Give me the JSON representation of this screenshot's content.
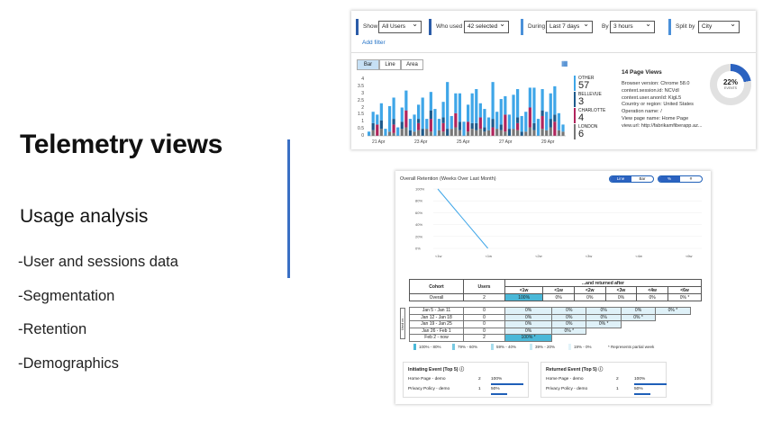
{
  "slide": {
    "title": "Telemetry views",
    "subtitle": "Usage analysis",
    "bullets": [
      "-User and sessions data",
      "-Segmentation",
      "-Retention",
      "-Demographics"
    ],
    "accent": "#3a6fc4"
  },
  "usage": {
    "filters": {
      "show_label": "Show",
      "show_value": "All Users",
      "who_label": "Who used",
      "who_value": "42 selected",
      "during_label": "During",
      "during_value": "Last 7 days",
      "by_label": "By",
      "by_value": "3 hours",
      "split_label": "Split by",
      "split_value": "City"
    },
    "add_filter": "Add filter",
    "chart_types": [
      "Bar",
      "Line",
      "Area"
    ],
    "selected_chart_type": "Bar",
    "legend": [
      {
        "name": "OTHER",
        "value": "57",
        "color": "#3fa6e8"
      },
      {
        "name": "BELLEVUE",
        "value": "3",
        "color": "#1e5a8c"
      },
      {
        "name": "CHARLOTTE",
        "value": "4",
        "color": "#b0245c"
      },
      {
        "name": "LONDON",
        "value": "6",
        "color": "#777777"
      }
    ],
    "page_views_title": "14 Page Views",
    "details": [
      "Browser version: Chrome 58.0",
      "context.session.id: NCVdl",
      "context.user.anonId: KigL5",
      "Country or region: United States",
      "Operation name: /",
      "View page name: Home Page",
      "view.url: http://fabrikamfiberapp.az..."
    ],
    "donut_pct": "22%",
    "donut_label": "EVENTS",
    "donut_fraction": 0.22
  },
  "chart_data": {
    "type": "bar",
    "title": "",
    "xlabel": "",
    "ylabel": "",
    "ylim": [
      0,
      4
    ],
    "yticks": [
      "4",
      "3.5",
      "3",
      "2.5",
      "2",
      "1.5",
      "1",
      "0.5",
      "0"
    ],
    "xticks": [
      "21 Apr",
      "23 Apr",
      "25 Apr",
      "27 Apr",
      "29 Apr"
    ],
    "stacked": true,
    "series": [
      {
        "name": "LONDON",
        "color": "#777777",
        "values": [
          0,
          0.4,
          0,
          0.5,
          0,
          0.3,
          0.2,
          0,
          0.5,
          0.6,
          0,
          0.3,
          0.4,
          0,
          0.5,
          0.3,
          0,
          0.4,
          0.3,
          0,
          0.5,
          0.6,
          0.4,
          0,
          0.3,
          0.5,
          0.4,
          0.5,
          0.3,
          0.4,
          0,
          0.5,
          0.4,
          0.3,
          0,
          0.5,
          0.4,
          0,
          0.3,
          0.6,
          0.4,
          0,
          0.5,
          0.4,
          0.6,
          0,
          0.4,
          0.3
        ]
      },
      {
        "name": "CHARLOTTE",
        "color": "#b0245c",
        "values": [
          0,
          0,
          0.8,
          0,
          0,
          0,
          0.6,
          0,
          0,
          1.2,
          0,
          0,
          0.5,
          0,
          0,
          0.9,
          0,
          0,
          0.6,
          0,
          0,
          1.0,
          0,
          0,
          0.7,
          0,
          0,
          0.8,
          0,
          0,
          0.6,
          0,
          0,
          1.2,
          0,
          0,
          0.5,
          0,
          0,
          1.4,
          0,
          0,
          0.9,
          0,
          0,
          1.0,
          0,
          0
        ]
      },
      {
        "name": "BELLEVUE",
        "color": "#1e5a8c",
        "values": [
          0,
          0.5,
          0,
          0.6,
          0,
          0,
          0.4,
          0,
          0.5,
          0,
          0.4,
          0,
          0.3,
          0.5,
          0,
          0.6,
          0,
          0,
          0.4,
          0.5,
          0,
          0,
          0.6,
          0,
          0,
          0.4,
          0.5,
          0,
          0.3,
          0,
          0.6,
          0,
          0.4,
          0,
          0.5,
          0,
          0.4,
          0.3,
          0,
          0,
          0.5,
          0,
          0.4,
          0,
          0.6,
          0.5,
          0,
          0
        ]
      },
      {
        "name": "OTHER",
        "color": "#3fa6e8",
        "values": [
          0.3,
          0.8,
          0.7,
          1.2,
          0.5,
          1.8,
          1.5,
          0.6,
          1.0,
          1.4,
          0.8,
          1.2,
          1.0,
          2.2,
          0.7,
          1.3,
          1.9,
          0.8,
          1.1,
          3.3,
          0.9,
          1.4,
          2.0,
          1.0,
          1.2,
          2.1,
          2.4,
          1.0,
          1.3,
          0.9,
          2.6,
          1.2,
          1.8,
          1.3,
          1.0,
          2.4,
          2.0,
          1.1,
          1.4,
          1.4,
          2.5,
          1.2,
          1.5,
          1.3,
          1.8,
          2.0,
          1.2,
          0.5
        ]
      }
    ]
  },
  "retention": {
    "title": "Overall Retention (Weeks Over Last Month)",
    "view_toggle": [
      "Line",
      "Bar"
    ],
    "unit_toggle": [
      "%",
      "#"
    ],
    "line_yticks": [
      "100%",
      "80%",
      "60%",
      "40%",
      "20%",
      "0%"
    ],
    "line_xticks": [
      "<1w",
      "<1w",
      "<2w",
      "<3w",
      "<4w",
      "<6w"
    ],
    "line_points": [
      100,
      0,
      0,
      0,
      0,
      0
    ],
    "table_headers": [
      "Cohort",
      "Users",
      "...and returned after"
    ],
    "table_periods": [
      "<1w",
      "<1w",
      "<2w",
      "<3w",
      "<4w",
      "<6w"
    ],
    "overall": [
      "Overall",
      "2",
      "100%",
      "0%",
      "0%",
      "0%",
      "0%",
      "0% *"
    ],
    "cohort_axis": "Used on...",
    "cohorts": [
      {
        "label": "Jan 5 - Jan 11",
        "users": "0",
        "cells": [
          "0%",
          "0%",
          "0%",
          "0%",
          "0% *"
        ]
      },
      {
        "label": "Jan 12 - Jan 18",
        "users": "0",
        "cells": [
          "0%",
          "0%",
          "0%",
          "0% *"
        ]
      },
      {
        "label": "Jan 19 - Jan 25",
        "users": "0",
        "cells": [
          "0%",
          "0%",
          "0% *"
        ]
      },
      {
        "label": "Jan 26 - Feb 1",
        "users": "0",
        "cells": [
          "0%",
          "0% *"
        ]
      },
      {
        "label": "Feb 2 - now",
        "users": "2",
        "cells": [
          "100% *"
        ]
      }
    ],
    "legend": [
      {
        "label": "100% - 80%",
        "color": "#4ab8d8"
      },
      {
        "label": "79% - 60%",
        "color": "#78c9e2"
      },
      {
        "label": "59% - 40%",
        "color": "#a6dcec"
      },
      {
        "label": "39% - 20%",
        "color": "#c8e9f3"
      },
      {
        "label": "19% - 0%",
        "color": "#e2f3f9"
      }
    ],
    "partial_note": "* Represents partial week",
    "initiating": {
      "title": "Initiating Event (Top 5)",
      "rows": [
        {
          "name": "Home Page - demo",
          "count": "2",
          "pct": "100%",
          "frac": 1.0
        },
        {
          "name": "Privacy Policy - demo",
          "count": "1",
          "pct": "50%",
          "frac": 0.5
        }
      ]
    },
    "returned": {
      "title": "Returned Event (Top 5)",
      "rows": [
        {
          "name": "Home Page - demo",
          "count": "2",
          "pct": "100%",
          "frac": 1.0
        },
        {
          "name": "Privacy Policy - demo",
          "count": "1",
          "pct": "50%",
          "frac": 0.5
        }
      ]
    }
  }
}
